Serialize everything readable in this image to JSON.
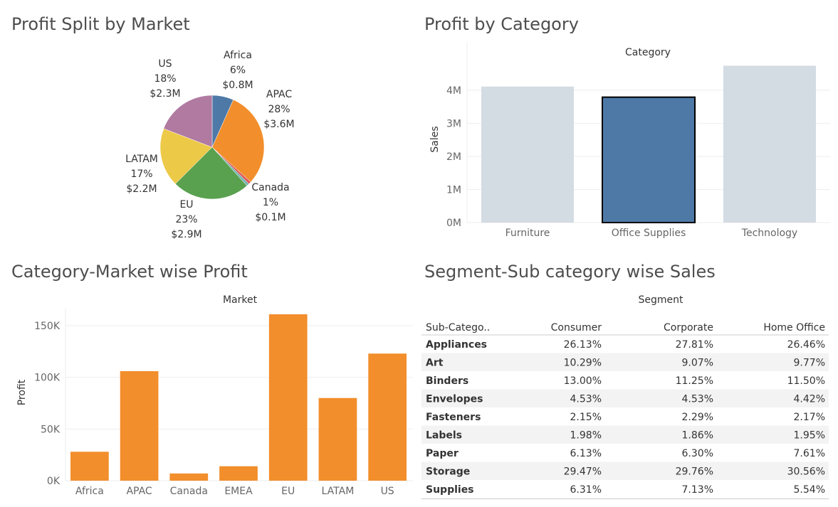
{
  "titles": {
    "pie": "Profit Split by Market",
    "category": "Profit by Category",
    "market": "Category-Market wise Profit",
    "segment": "Segment-Sub category wise Sales"
  },
  "colors": {
    "grid": "#eeeeee",
    "bar_orange": "#f28e2b",
    "bar_light": "#d3dbe3",
    "bar_selected": "#4e79a7"
  },
  "chart_data": [
    {
      "type": "pie",
      "slices": [
        {
          "label": "Africa",
          "pct_label": "6%",
          "value_label": "$0.8M",
          "value": 0.8,
          "color": "#4e79a7"
        },
        {
          "label": "APAC",
          "pct_label": "28%",
          "value_label": "$3.6M",
          "value": 3.6,
          "color": "#f28e2b"
        },
        {
          "label": "",
          "pct_label": "",
          "value_label": "",
          "value": 0.1,
          "color": "#e15759"
        },
        {
          "label": "Canada",
          "pct_label": "1%",
          "value_label": "$0.1M",
          "value": 0.1,
          "color": "#76b7b2"
        },
        {
          "label": "EU",
          "pct_label": "23%",
          "value_label": "$2.9M",
          "value": 2.9,
          "color": "#59a14f"
        },
        {
          "label": "LATAM",
          "pct_label": "17%",
          "value_label": "$2.2M",
          "value": 2.2,
          "color": "#edc948"
        },
        {
          "label": "US",
          "pct_label": "18%",
          "value_label": "$2.3M",
          "value": 2.3,
          "color": "#b07aa1"
        }
      ]
    },
    {
      "type": "bar",
      "header": "Category",
      "ylabel": "Sales",
      "categories": [
        "Furniture",
        "Office Supplies",
        "Technology"
      ],
      "values": [
        4.11,
        3.79,
        4.74
      ],
      "ylim": [
        0,
        4.9
      ],
      "yticks": [
        0,
        1,
        2,
        3,
        4
      ],
      "ytick_labels": [
        "0M",
        "1M",
        "2M",
        "3M",
        "4M"
      ],
      "selected": "Office Supplies"
    },
    {
      "type": "bar",
      "header": "Market",
      "ylabel": "Profit",
      "categories": [
        "Africa",
        "APAC",
        "Canada",
        "EMEA",
        "EU",
        "LATAM",
        "US"
      ],
      "values": [
        28000,
        106000,
        7000,
        14000,
        161000,
        80000,
        123000
      ],
      "ylim": [
        0,
        161000
      ],
      "yticks": [
        0,
        50000,
        100000,
        150000
      ],
      "ytick_labels": [
        "0K",
        "50K",
        "100K",
        "150K"
      ]
    },
    {
      "type": "table",
      "header": "Segment",
      "row_header": "Sub-Catego..",
      "columns": [
        "Consumer",
        "Corporate",
        "Home Office"
      ],
      "rows": [
        {
          "name": "Appliances",
          "values": [
            "26.13%",
            "27.81%",
            "26.46%"
          ]
        },
        {
          "name": "Art",
          "values": [
            "10.29%",
            "9.07%",
            "9.77%"
          ]
        },
        {
          "name": "Binders",
          "values": [
            "13.00%",
            "11.25%",
            "11.50%"
          ]
        },
        {
          "name": "Envelopes",
          "values": [
            "4.53%",
            "4.53%",
            "4.42%"
          ]
        },
        {
          "name": "Fasteners",
          "values": [
            "2.15%",
            "2.29%",
            "2.17%"
          ]
        },
        {
          "name": "Labels",
          "values": [
            "1.98%",
            "1.86%",
            "1.95%"
          ]
        },
        {
          "name": "Paper",
          "values": [
            "6.13%",
            "6.30%",
            "7.61%"
          ]
        },
        {
          "name": "Storage",
          "values": [
            "29.47%",
            "29.76%",
            "30.56%"
          ]
        },
        {
          "name": "Supplies",
          "values": [
            "6.31%",
            "7.13%",
            "5.54%"
          ]
        }
      ]
    }
  ]
}
